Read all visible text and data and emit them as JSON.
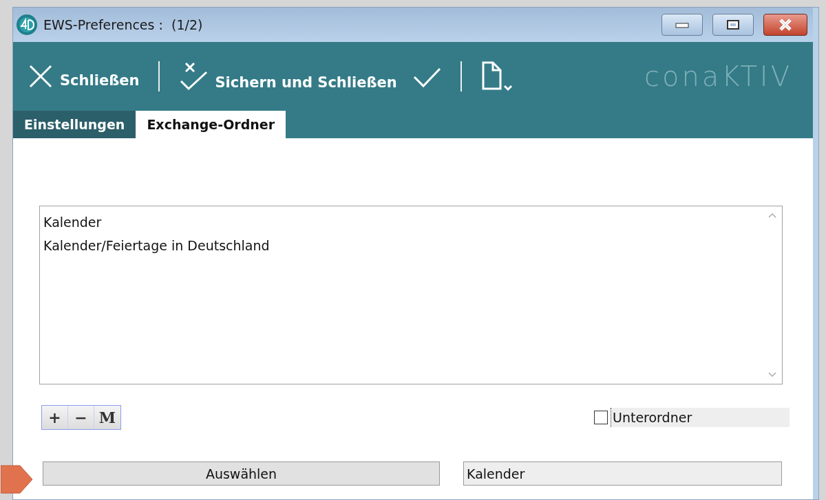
{
  "window": {
    "title": "EWS-Preferences :  (1/2)"
  },
  "toolbar": {
    "items": [
      {
        "kind": "close",
        "label": "Schließen"
      },
      {
        "kind": "separator"
      },
      {
        "kind": "save-close",
        "label": "Sichern und Schließen"
      },
      {
        "kind": "apply"
      },
      {
        "kind": "separator"
      },
      {
        "kind": "new-menu"
      }
    ],
    "logo": "conaKTIV"
  },
  "tabs": [
    {
      "label": "Einstellungen",
      "selected": false
    },
    {
      "label": "Exchange-Ordner",
      "selected": true
    }
  ],
  "folder_list": {
    "items": [
      "Kalender",
      "Kalender/Feiertage in Deutschland"
    ]
  },
  "list_buttons": [
    "+",
    "−",
    "M"
  ],
  "subfolder": {
    "label": "Unterordner",
    "checked": false
  },
  "select_button": "Auswählen",
  "selected_folder": {
    "value": "Kalender"
  }
}
